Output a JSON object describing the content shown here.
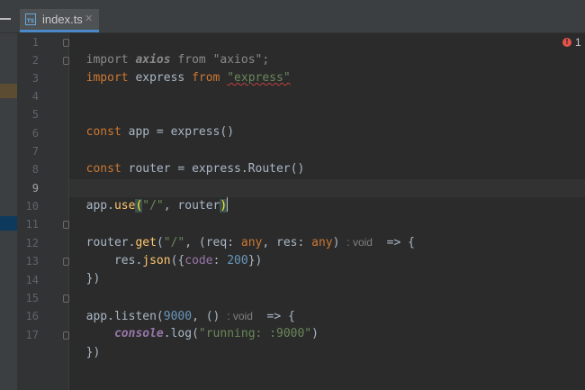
{
  "tab": {
    "filename": "index.ts",
    "icon_label": "TS",
    "close_glyph": "✕",
    "accent": "#4a88c7"
  },
  "error_indicator": {
    "icon": "error-icon",
    "glyph": "!",
    "count": "1",
    "color": "#e5534b"
  },
  "editor": {
    "current_line": 9,
    "line_numbers": [
      "1",
      "2",
      "3",
      "4",
      "5",
      "6",
      "7",
      "8",
      "9",
      "10",
      "11",
      "12",
      "13",
      "14",
      "15",
      "16",
      "17"
    ],
    "lines": {
      "l1": {
        "t1": "import ",
        "t2": "axios",
        "t3": " from ",
        "t4": "\"axios\"",
        "t5": ";"
      },
      "l2": {
        "t1": "import",
        "t2": " express ",
        "t3": "from",
        "t4": " ",
        "t5": "\"express\""
      },
      "l5": {
        "t1": "const",
        "t2": " app = express()"
      },
      "l7": {
        "t1": "const",
        "t2": " router = express.Router()"
      },
      "l9": {
        "t1": "app.",
        "t2": "use",
        "t3": "(",
        "t4": "\"/\"",
        "t5": ", router",
        "t6": ")"
      },
      "l11": {
        "t1": "router.",
        "t2": "get",
        "t3": "(",
        "t4": "\"/\"",
        "t5": ", (req: ",
        "t6": "any",
        "t7": ", res: ",
        "t8": "any",
        "t9": ") ",
        "t10": ": void",
        "t11": "  => {"
      },
      "l12": {
        "t1": "    res.",
        "t2": "json",
        "t3": "({",
        "t4": "code",
        "t5": ": ",
        "t6": "200",
        "t7": "})"
      },
      "l13": {
        "t1": "})"
      },
      "l15": {
        "t1": "app.listen(",
        "t2": "9000",
        "t3": ", () ",
        "t4": ": void",
        "t5": "  => {"
      },
      "l16": {
        "t1": "    ",
        "t2": "console",
        "t3": ".log(",
        "t4": "\"running: :9000\"",
        "t5": ")"
      },
      "l17": {
        "t1": "})"
      }
    }
  }
}
